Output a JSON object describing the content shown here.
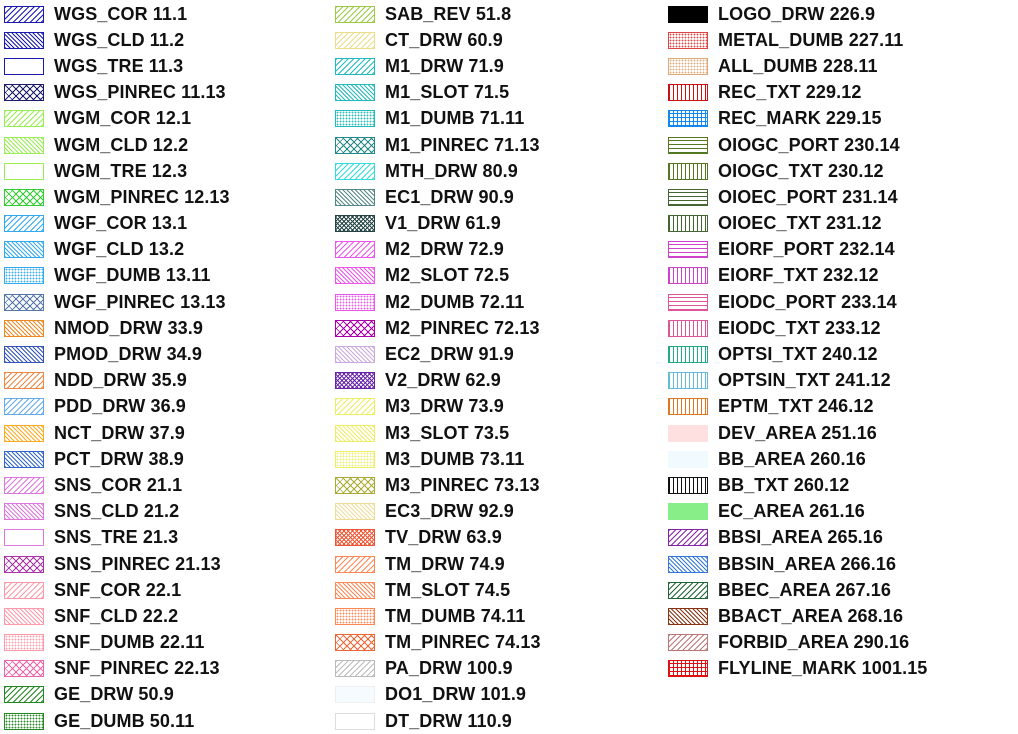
{
  "columns": [
    [
      {
        "label": "WGS_COR 11.1",
        "color": "#1b1bb0",
        "pattern": "diag"
      },
      {
        "label": "WGS_CLD 11.2",
        "color": "#1b1bb0",
        "pattern": "bdiag-dense"
      },
      {
        "label": "WGS_TRE 11.3",
        "color": "#1b1bb0",
        "pattern": "empty"
      },
      {
        "label": "WGS_PINREC 11.13",
        "color": "#1b1b70",
        "pattern": "cross"
      },
      {
        "label": "WGM_COR 12.1",
        "color": "#9aee55",
        "pattern": "diag"
      },
      {
        "label": "WGM_CLD 12.2",
        "color": "#9aee55",
        "pattern": "bdiag-dense"
      },
      {
        "label": "WGM_TRE 12.3",
        "color": "#9aee55",
        "pattern": "empty"
      },
      {
        "label": "WGM_PINREC 12.13",
        "color": "#33cc33",
        "pattern": "cross"
      },
      {
        "label": "WGF_COR 13.1",
        "color": "#33aaee",
        "pattern": "diag"
      },
      {
        "label": "WGF_CLD 13.2",
        "color": "#33aaee",
        "pattern": "bdiag-dense"
      },
      {
        "label": "WGF_DUMB 13.11",
        "color": "#33aaee",
        "pattern": "dots"
      },
      {
        "label": "WGF_PINREC 13.13",
        "color": "#5577aa",
        "pattern": "cross"
      },
      {
        "label": "NMOD_DRW 33.9",
        "color": "#ee8822",
        "pattern": "bdiag-dense"
      },
      {
        "label": "PMOD_DRW 34.9",
        "color": "#3355bb",
        "pattern": "bdiag-dense"
      },
      {
        "label": "NDD_DRW 35.9",
        "color": "#ee8844",
        "pattern": "diag"
      },
      {
        "label": "PDD_DRW 36.9",
        "color": "#66aaee",
        "pattern": "diag"
      },
      {
        "label": "NCT_DRW 37.9",
        "color": "#ffaa22",
        "pattern": "bdiag-dense"
      },
      {
        "label": "PCT_DRW 38.9",
        "color": "#3366cc",
        "pattern": "bdiag-dense"
      },
      {
        "label": "SNS_COR 21.1",
        "color": "#dd77dd",
        "pattern": "diag"
      },
      {
        "label": "SNS_CLD 21.2",
        "color": "#dd77dd",
        "pattern": "bdiag-dense"
      },
      {
        "label": "SNS_TRE 21.3",
        "color": "#dd77dd",
        "pattern": "empty"
      },
      {
        "label": "SNS_PINREC 21.13",
        "color": "#aa33aa",
        "pattern": "cross"
      },
      {
        "label": "SNF_COR 22.1",
        "color": "#ff99aa",
        "pattern": "diag"
      },
      {
        "label": "SNF_CLD 22.2",
        "color": "#ff99aa",
        "pattern": "bdiag-dense"
      },
      {
        "label": "SNF_DUMB 22.11",
        "color": "#ff99aa",
        "pattern": "dots"
      },
      {
        "label": "SNF_PINREC 22.13",
        "color": "#ee66aa",
        "pattern": "cross"
      },
      {
        "label": "GE_DRW 50.9",
        "color": "#228822",
        "pattern": "diag"
      },
      {
        "label": "GE_DUMB 50.11",
        "color": "#228822",
        "pattern": "dots"
      }
    ],
    [
      {
        "label": "SAB_REV 51.8",
        "color": "#99cc44",
        "pattern": "diag"
      },
      {
        "label": "CT_DRW 60.9",
        "color": "#eedd88",
        "pattern": "diag"
      },
      {
        "label": "M1_DRW 71.9",
        "color": "#22bbbb",
        "pattern": "diag"
      },
      {
        "label": "M1_SLOT 71.5",
        "color": "#22bbbb",
        "pattern": "bdiag-dense"
      },
      {
        "label": "M1_DUMB 71.11",
        "color": "#22bbbb",
        "pattern": "dots"
      },
      {
        "label": "M1_PINREC 71.13",
        "color": "#228888",
        "pattern": "cross"
      },
      {
        "label": "MTH_DRW 80.9",
        "color": "#33dddd",
        "pattern": "diag"
      },
      {
        "label": "EC1_DRW 90.9",
        "color": "#558888",
        "pattern": "bdiag-dense"
      },
      {
        "label": "V1_DRW 61.9",
        "color": "#224444",
        "pattern": "cross-dense"
      },
      {
        "label": "M2_DRW 72.9",
        "color": "#ee55ee",
        "pattern": "diag"
      },
      {
        "label": "M2_SLOT 72.5",
        "color": "#ee55ee",
        "pattern": "bdiag-dense"
      },
      {
        "label": "M2_DUMB 72.11",
        "color": "#ee55ee",
        "pattern": "dots"
      },
      {
        "label": "M2_PINREC 72.13",
        "color": "#aa00aa",
        "pattern": "cross"
      },
      {
        "label": "EC2_DRW 91.9",
        "color": "#ccaadd",
        "pattern": "bdiag-dense"
      },
      {
        "label": "V2_DRW 62.9",
        "color": "#6622aa",
        "pattern": "cross-dense"
      },
      {
        "label": "M3_DRW 73.9",
        "color": "#eeee66",
        "pattern": "diag"
      },
      {
        "label": "M3_SLOT 73.5",
        "color": "#eeee66",
        "pattern": "bdiag-dense"
      },
      {
        "label": "M3_DUMB 73.11",
        "color": "#eeee66",
        "pattern": "dots"
      },
      {
        "label": "M3_PINREC 73.13",
        "color": "#aaaa33",
        "pattern": "cross"
      },
      {
        "label": "EC3_DRW 92.9",
        "color": "#eedd99",
        "pattern": "bdiag-dense"
      },
      {
        "label": "TV_DRW 63.9",
        "color": "#ee5533",
        "pattern": "cross-dense"
      },
      {
        "label": "TM_DRW 74.9",
        "color": "#ff8855",
        "pattern": "diag"
      },
      {
        "label": "TM_SLOT 74.5",
        "color": "#ff8855",
        "pattern": "bdiag-dense"
      },
      {
        "label": "TM_DUMB 74.11",
        "color": "#ff8855",
        "pattern": "dots"
      },
      {
        "label": "TM_PINREC 74.13",
        "color": "#ee6633",
        "pattern": "cross"
      },
      {
        "label": "PA_DRW 100.9",
        "color": "#bbbbbb",
        "pattern": "diag"
      },
      {
        "label": "DO1_DRW 101.9",
        "color": "#eeeeee",
        "pattern": "empty-fill",
        "fill": "#f6fbff"
      },
      {
        "label": "DT_DRW 110.9",
        "color": "#dddddd",
        "pattern": "empty"
      }
    ],
    [
      {
        "label": "LOGO_DRW 226.9",
        "color": "#000000",
        "pattern": "solid",
        "fill": "#000000"
      },
      {
        "label": "METAL_DUMB 227.11",
        "color": "#dd4444",
        "pattern": "dots"
      },
      {
        "label": "ALL_DUMB 228.11",
        "color": "#ddaa77",
        "pattern": "dots"
      },
      {
        "label": "REC_TXT 229.12",
        "color": "#cc1111",
        "pattern": "vlines"
      },
      {
        "label": "REC_MARK 229.15",
        "color": "#1188ee",
        "pattern": "grid"
      },
      {
        "label": "OIOGC_PORT 230.14",
        "color": "#557722",
        "pattern": "hlines"
      },
      {
        "label": "OIOGC_TXT 230.12",
        "color": "#557722",
        "pattern": "vlines"
      },
      {
        "label": "OIOEC_PORT 231.14",
        "color": "#446633",
        "pattern": "hlines"
      },
      {
        "label": "OIOEC_TXT 231.12",
        "color": "#446633",
        "pattern": "vlines"
      },
      {
        "label": "EIORF_PORT 232.14",
        "color": "#cc44cc",
        "pattern": "hlines"
      },
      {
        "label": "EIORF_TXT 232.12",
        "color": "#cc44cc",
        "pattern": "vlines"
      },
      {
        "label": "EIODC_PORT 233.14",
        "color": "#dd5599",
        "pattern": "hlines"
      },
      {
        "label": "EIODC_TXT 233.12",
        "color": "#dd5599",
        "pattern": "vlines"
      },
      {
        "label": "OPTSI_TXT 240.12",
        "color": "#22aa88",
        "pattern": "vlines"
      },
      {
        "label": "OPTSIN_TXT 241.12",
        "color": "#66bbdd",
        "pattern": "vlines"
      },
      {
        "label": "EPTM_TXT 246.12",
        "color": "#dd7722",
        "pattern": "vlines"
      },
      {
        "label": "DEV_AREA 251.16",
        "color": "#ffe0e0",
        "pattern": "solid",
        "fill": "#ffe0e0"
      },
      {
        "label": "BB_AREA 260.16",
        "color": "#f0faff",
        "pattern": "solid",
        "fill": "#f0faff"
      },
      {
        "label": "BB_TXT 260.12",
        "color": "#111111",
        "pattern": "vlines"
      },
      {
        "label": "EC_AREA 261.16",
        "color": "#88ee88",
        "pattern": "solid",
        "fill": "#88ee88"
      },
      {
        "label": "BBSI_AREA 265.16",
        "color": "#8822aa",
        "pattern": "diag"
      },
      {
        "label": "BBSIN_AREA 266.16",
        "color": "#3377dd",
        "pattern": "bdiag-dense"
      },
      {
        "label": "BBEC_AREA 267.16",
        "color": "#226633",
        "pattern": "diag"
      },
      {
        "label": "BBACT_AREA 268.16",
        "color": "#883311",
        "pattern": "bdiag-dense"
      },
      {
        "label": "FORBID_AREA 290.16",
        "color": "#bb7777",
        "pattern": "diag"
      },
      {
        "label": "FLYLINE_MARK 1001.15",
        "color": "#dd1111",
        "pattern": "grid"
      }
    ]
  ]
}
